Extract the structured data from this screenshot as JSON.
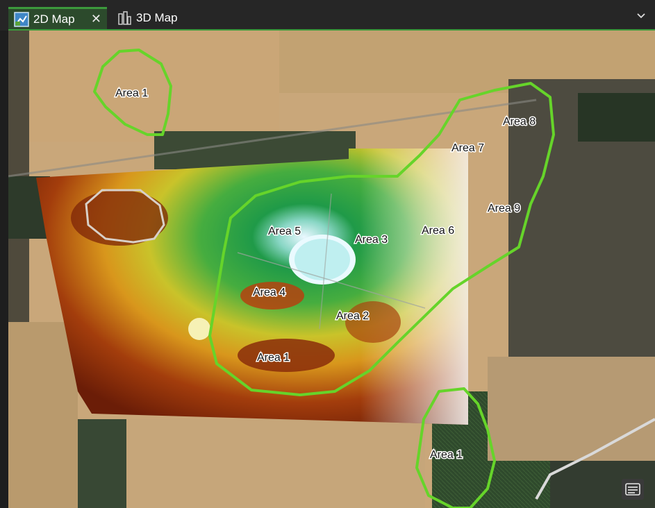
{
  "tabs": [
    {
      "label": "2D Map",
      "active": true,
      "icon": "map-2d-icon",
      "closable": true
    },
    {
      "label": "3D Map",
      "active": false,
      "icon": "map-3d-icon",
      "closable": false
    }
  ],
  "close_glyph": "✕",
  "map": {
    "labels": {
      "area1_top": "Area 1",
      "area8": "Area 8",
      "area7": "Area 7",
      "area9": "Area 9",
      "area5": "Area 5",
      "area3": "Area 3",
      "area6": "Area 6",
      "area4": "Area 4",
      "area2": "Area 2",
      "area1_mid": "Area 1",
      "area1_bottom": "Area 1"
    },
    "colors": {
      "zone_outline": "#66d42a",
      "tab_accent": "#3c9a3c"
    }
  }
}
